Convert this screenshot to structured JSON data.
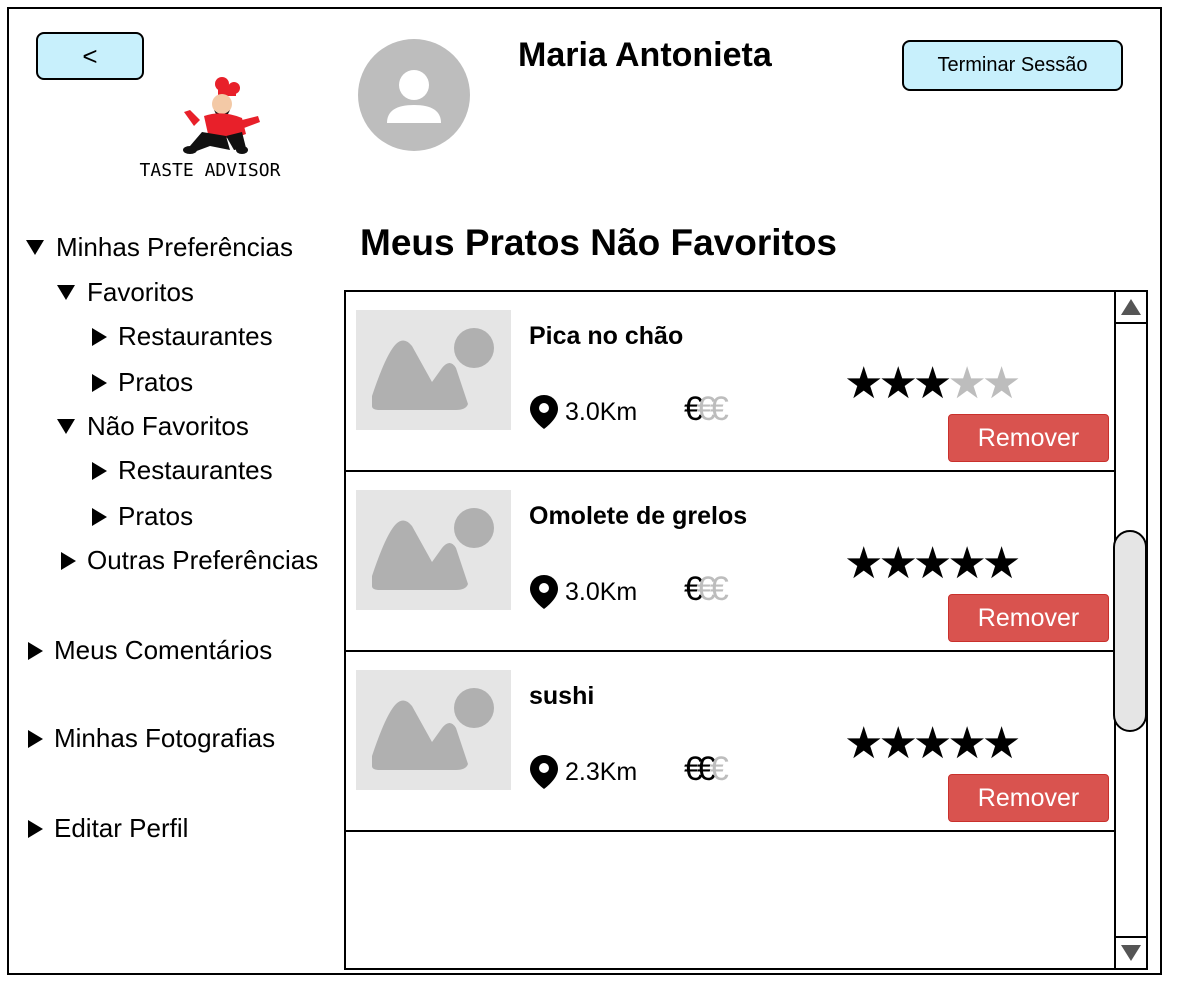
{
  "header": {
    "back_label": "<",
    "username": "Maria Antonieta",
    "logout_label": "Terminar Sessão",
    "logo_text": "TASTE ADVISOR"
  },
  "nav": {
    "preferences": "Minhas Preferências",
    "favorites": "Favoritos",
    "fav_restaurants": "Restaurantes",
    "fav_dishes": "Pratos",
    "non_favorites": "Não Favoritos",
    "nonfav_restaurants": "Restaurantes",
    "nonfav_dishes": "Pratos",
    "other_prefs": "Outras Preferências",
    "comments": "Meus Comentários",
    "photos": "Minhas Fotografias",
    "edit_profile": "Editar Perfil"
  },
  "page_title": "Meus Pratos Não Favoritos",
  "dishes": [
    {
      "name": "Pica no chão",
      "distance": "3.0Km",
      "price_level": 1,
      "rating": 3,
      "remove_label": "Remover"
    },
    {
      "name": "Omolete de grelos",
      "distance": "3.0Km",
      "price_level": 1,
      "rating": 5,
      "remove_label": "Remover"
    },
    {
      "name": "sushi",
      "distance": "2.3Km",
      "price_level": 2,
      "rating": 5,
      "remove_label": "Remover"
    }
  ],
  "price_symbol": "€",
  "price_max": 3,
  "rating_max": 5,
  "colors": {
    "button_light": "#c8f0fc",
    "remove_red": "#d9534f",
    "inactive_gray": "#bdbdbd"
  }
}
